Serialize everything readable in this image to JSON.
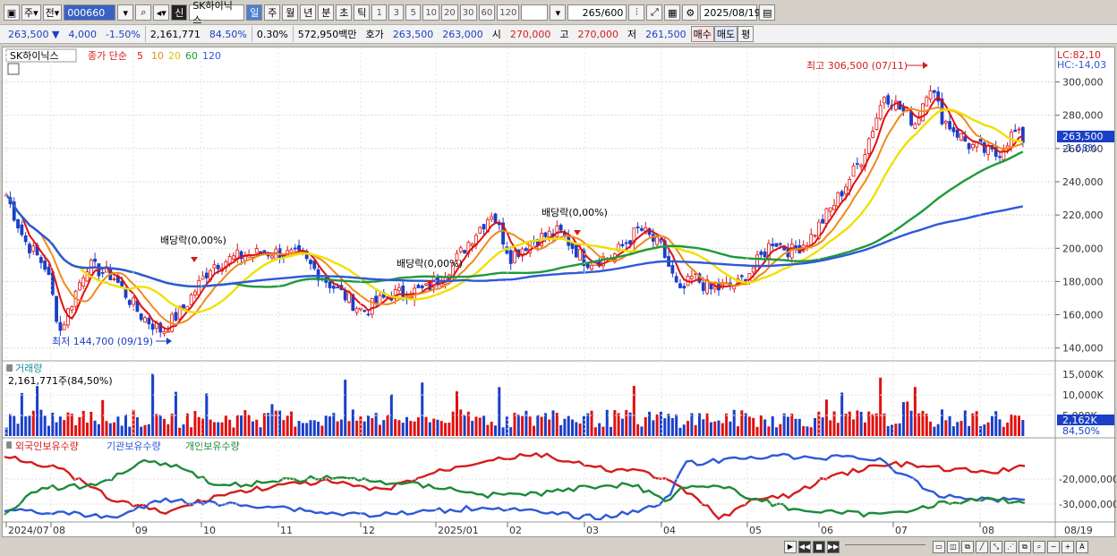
{
  "toolbar": {
    "period_select": "주",
    "mode_select": "전",
    "code": "000660",
    "credit_badge": "신",
    "stock_name": "SK하이닉스",
    "period_tabs": [
      "일",
      "주",
      "월",
      "년",
      "분",
      "초",
      "틱"
    ],
    "active_tab": "일",
    "minute_buttons": [
      "1",
      "3",
      "5",
      "10",
      "20",
      "30",
      "60",
      "120"
    ],
    "count_value": "265",
    "count_total": "/600",
    "date": "2025/08/19"
  },
  "quote": {
    "price": "263,500",
    "arrow": "▼",
    "change": "4,000",
    "change_pct": "-1.50%",
    "volume": "2,161,771",
    "vol_ratio": "84.50%",
    "turnover": "0.30%",
    "amount": "572,950백만",
    "ask_label": "호가",
    "ask": "263,500",
    "bid": "263,000",
    "open_label": "시",
    "open": "270,000",
    "high_label": "고",
    "high": "270,000",
    "low_label": "저",
    "low": "261,500",
    "buy_btn": "매수",
    "sell_btn": "매도",
    "eval_btn": "평"
  },
  "price_chart": {
    "name_label": "SK하이닉스",
    "ma_label": "종가 단순",
    "ma_periods": [
      "5",
      "10",
      "20",
      "60",
      "120"
    ],
    "ma_colors": [
      "#e01010",
      "#f08a1a",
      "#f0e000",
      "#1e9a3a",
      "#2f58d8"
    ],
    "lc_label": "LC:82,10",
    "hc_label": "HC:-14,03",
    "y_ticks": [
      "300,000",
      "280,000",
      "260,000",
      "240,000",
      "220,000",
      "200,000",
      "180,000",
      "160,000",
      "140,000"
    ],
    "current_price_tag": "263,500",
    "current_change_tag": "-1,68%",
    "high_annotation": "최고 306,500 (07/11)",
    "low_annotation": "최저 144,700 (09/19)",
    "dividend_labels": [
      "배당락(0,00%)",
      "배당락(0,00%)",
      "배당락(0,00%)"
    ]
  },
  "volume_chart": {
    "title": "거래량",
    "value_label": "2,161,771주(84,50%)",
    "y_ticks": [
      "15,000K",
      "10,000K",
      "5,000K"
    ],
    "current_tag": "2,162K",
    "current_pct": "84,50%"
  },
  "holding_chart": {
    "series": [
      "외국인보유수량",
      "기관보유수량",
      "개인보유수량"
    ],
    "colors": [
      "#d61c1c",
      "#2f58d8",
      "#1e8a3a"
    ],
    "y_ticks": [
      "-20,000,000",
      "-30,000,000"
    ]
  },
  "x_axis": {
    "labels": [
      "2024/07",
      "08",
      "09",
      "10",
      "11",
      "12",
      "2025/01",
      "02",
      "03",
      "04",
      "05",
      "06",
      "07",
      "08"
    ],
    "right_label": "08/19"
  },
  "chart_data": {
    "type": "line",
    "x": [
      "2024/07",
      "08",
      "09",
      "10",
      "11",
      "12",
      "2025/01",
      "02",
      "03",
      "04",
      "05",
      "06",
      "07",
      "08"
    ],
    "series": [
      {
        "name": "종가",
        "values": [
          230000,
          190000,
          165000,
          190000,
          195000,
          170000,
          195000,
          210000,
          195000,
          205000,
          180000,
          200000,
          295000,
          265000
        ]
      }
    ],
    "ylim": [
      140000,
      305000
    ]
  }
}
